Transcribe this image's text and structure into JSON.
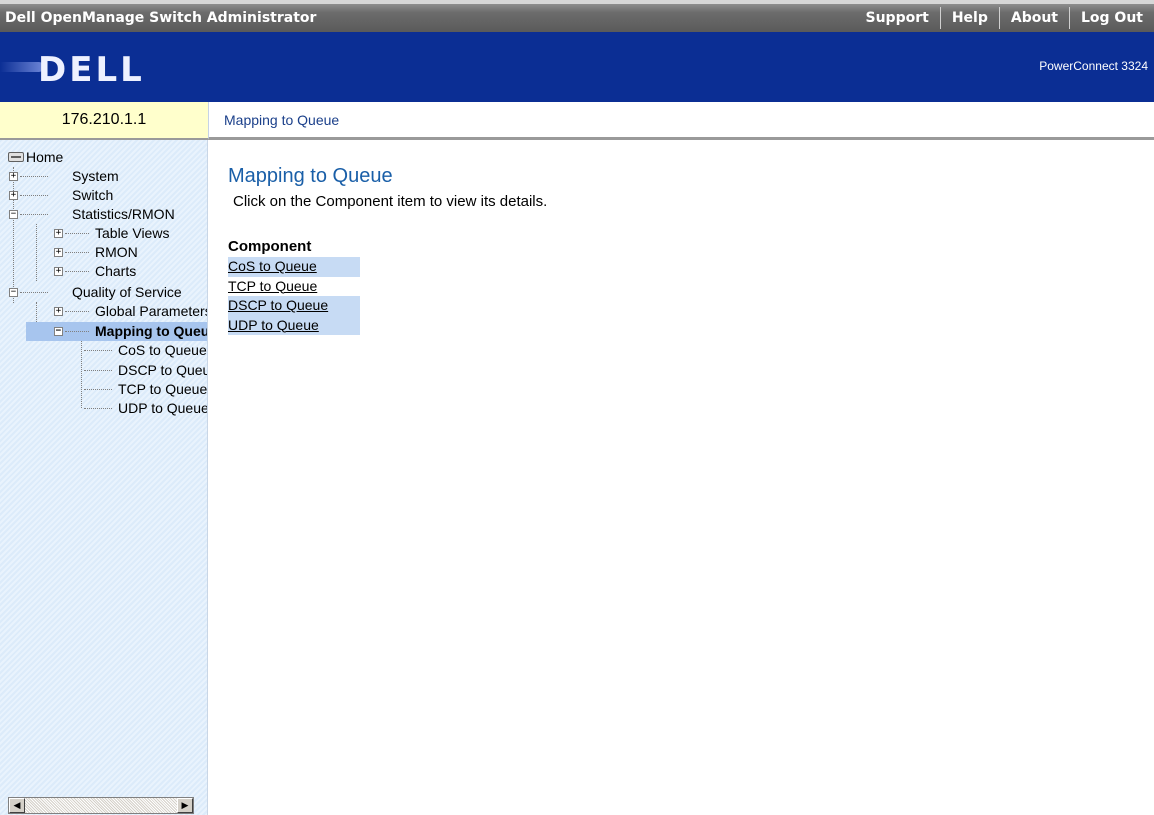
{
  "header": {
    "app_title": "Dell OpenManage Switch Administrator",
    "links": [
      "Support",
      "Help",
      "About",
      "Log Out"
    ]
  },
  "banner": {
    "logo_text": "DELL",
    "product": "PowerConnect 3324"
  },
  "address": "176.210.1.1",
  "breadcrumb": "Mapping to Queue",
  "tree": {
    "home": "Home",
    "system": "System",
    "switch": "Switch",
    "stats": "Statistics/RMON",
    "table_views": "Table Views",
    "rmon": "RMON",
    "charts": "Charts",
    "qos": "Quality of Service",
    "global_params": "Global Parameters",
    "mapping": "Mapping to Queue",
    "cos": "CoS to Queue",
    "dscp": "DSCP to Queue",
    "tcp": "TCP to Queue",
    "udp": "UDP to Queue"
  },
  "main": {
    "title": "Mapping to Queue",
    "description": "Click on the Component item to view its details.",
    "table_header": "Component",
    "rows": [
      "CoS to Queue",
      "TCP to Queue",
      "DSCP to Queue",
      "UDP to Queue"
    ]
  },
  "colors": {
    "banner": "#0b2e94",
    "title": "#1a5fa8",
    "selected": "#a7c5ee",
    "row_shade": "#c7dbf4"
  }
}
